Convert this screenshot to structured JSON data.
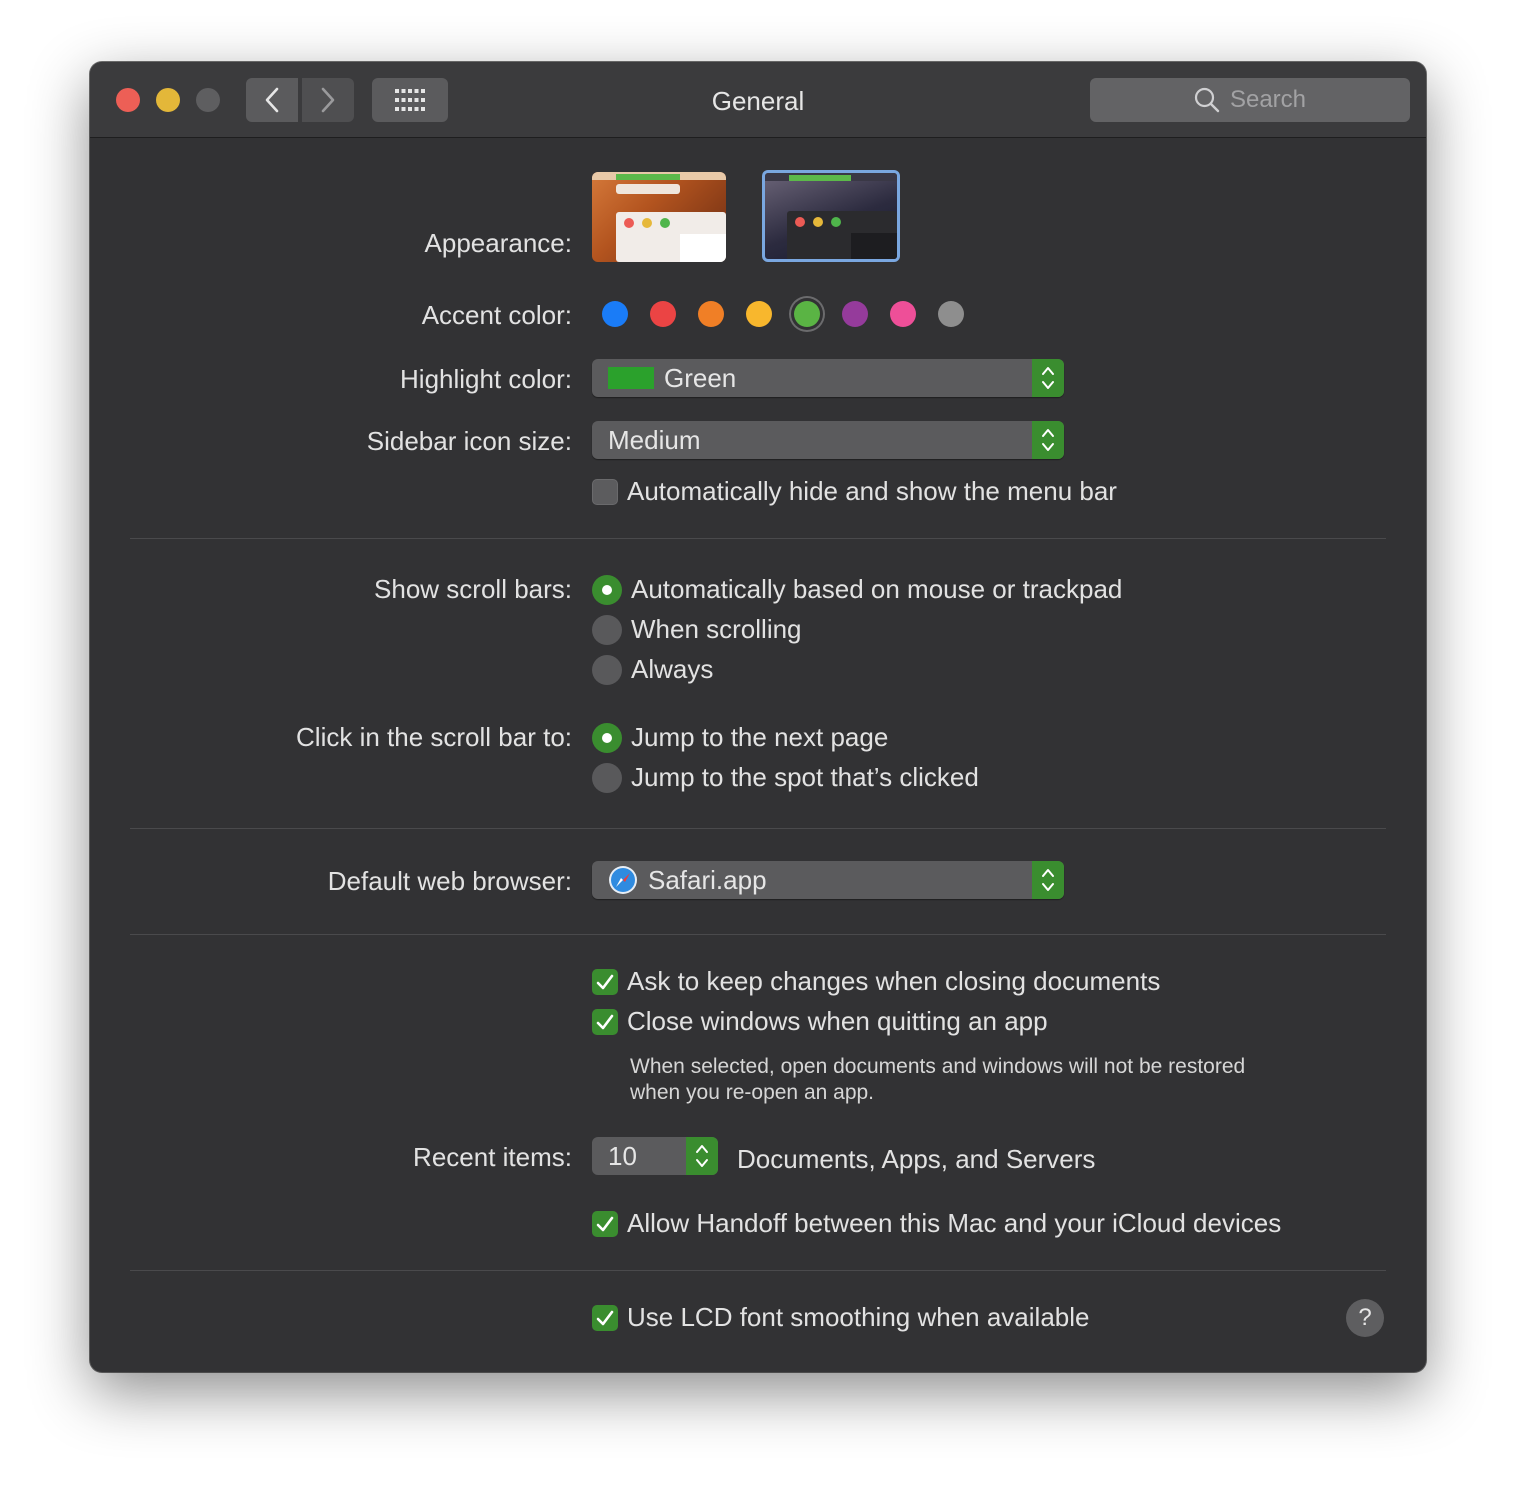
{
  "window": {
    "title": "General",
    "search_placeholder": "Search"
  },
  "appearance": {
    "label": "Appearance:",
    "options": [
      {
        "name": "light",
        "selected": false
      },
      {
        "name": "dark",
        "selected": true
      }
    ]
  },
  "accent_color": {
    "label": "Accent color:",
    "colors": [
      "#1a7cf7",
      "#eb4444",
      "#f07f26",
      "#f8b72d",
      "#5ab444",
      "#953b9b",
      "#ee4f98",
      "#8e8e8e"
    ],
    "selected_index": 4
  },
  "highlight_color": {
    "label": "Highlight color:",
    "value": "Green",
    "swatch": "#2ba12c"
  },
  "sidebar_icon_size": {
    "label": "Sidebar icon size:",
    "value": "Medium"
  },
  "menu_bar": {
    "label": "Automatically hide and show the menu bar",
    "checked": false
  },
  "scroll_bars": {
    "label": "Show scroll bars:",
    "options": [
      {
        "label": "Automatically based on mouse or trackpad",
        "selected": true
      },
      {
        "label": "When scrolling",
        "selected": false
      },
      {
        "label": "Always",
        "selected": false
      }
    ]
  },
  "scroll_click": {
    "label": "Click in the scroll bar to:",
    "options": [
      {
        "label": "Jump to the next page",
        "selected": true
      },
      {
        "label": "Jump to the spot that’s clicked",
        "selected": false
      }
    ]
  },
  "browser": {
    "label": "Default web browser:",
    "value": "Safari.app",
    "icon": "safari-icon"
  },
  "documents": {
    "ask_keep": {
      "label": "Ask to keep changes when closing documents",
      "checked": true
    },
    "close_windows": {
      "label": "Close windows when quitting an app",
      "checked": true
    },
    "note_line1": "When selected, open documents and windows will not be restored",
    "note_line2": "when you re-open an app."
  },
  "recent_items": {
    "label": "Recent items:",
    "value": "10",
    "suffix": "Documents, Apps, and Servers"
  },
  "handoff": {
    "label": "Allow Handoff between this Mac and your iCloud devices",
    "checked": true
  },
  "lcd": {
    "label": "Use LCD font smoothing when available",
    "checked": true
  },
  "help": {
    "label": "?"
  }
}
